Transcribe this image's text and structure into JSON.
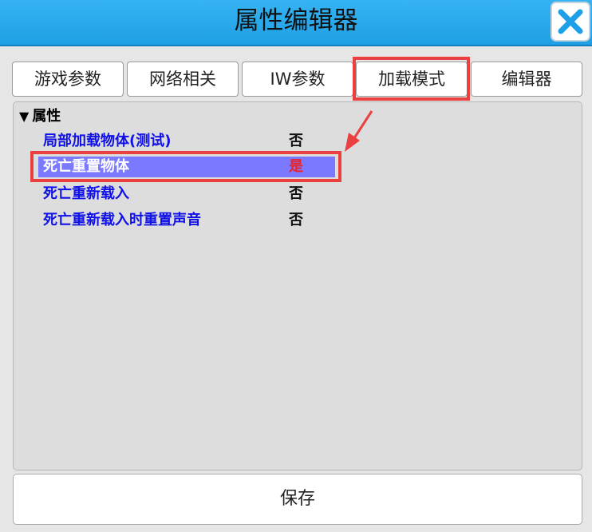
{
  "window": {
    "title": "属性编辑器"
  },
  "tabs": [
    {
      "label": "游戏参数"
    },
    {
      "label": "网络相关"
    },
    {
      "label": "IW参数"
    },
    {
      "label": "加载模式"
    },
    {
      "label": "编辑器"
    }
  ],
  "active_tab": "加载模式",
  "property_group": {
    "label": "属性",
    "expanded": true
  },
  "properties": [
    {
      "name": "局部加载物体(测试)",
      "value": "否"
    },
    {
      "name": "死亡重置物体",
      "value": "是",
      "selected": true
    },
    {
      "name": "死亡重新载入",
      "value": "否"
    },
    {
      "name": "死亡重新载入时重置声音",
      "value": "否"
    }
  ],
  "actions": {
    "save_label": "保存"
  },
  "colors": {
    "titlebar": "#2aa8ee",
    "annotation": "#ea4040",
    "selected_row": "#7b79ff",
    "property_name": "#1010e8"
  }
}
